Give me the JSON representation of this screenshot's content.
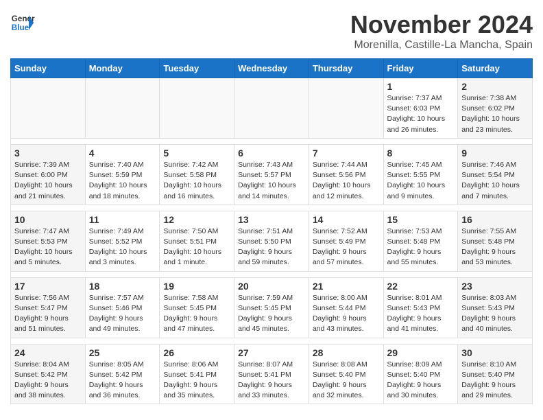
{
  "logo": {
    "line1": "General",
    "line2": "Blue"
  },
  "title": "November 2024",
  "location": "Morenilla, Castille-La Mancha, Spain",
  "weekdays": [
    "Sunday",
    "Monday",
    "Tuesday",
    "Wednesday",
    "Thursday",
    "Friday",
    "Saturday"
  ],
  "weeks": [
    {
      "days": [
        {
          "num": "",
          "info": "",
          "empty": true
        },
        {
          "num": "",
          "info": "",
          "empty": true
        },
        {
          "num": "",
          "info": "",
          "empty": true
        },
        {
          "num": "",
          "info": "",
          "empty": true
        },
        {
          "num": "",
          "info": "",
          "empty": true
        },
        {
          "num": "1",
          "info": "Sunrise: 7:37 AM\nSunset: 6:03 PM\nDaylight: 10 hours\nand 26 minutes."
        },
        {
          "num": "2",
          "info": "Sunrise: 7:38 AM\nSunset: 6:02 PM\nDaylight: 10 hours\nand 23 minutes.",
          "weekend": true
        }
      ]
    },
    {
      "days": [
        {
          "num": "3",
          "info": "Sunrise: 7:39 AM\nSunset: 6:00 PM\nDaylight: 10 hours\nand 21 minutes.",
          "weekend": true
        },
        {
          "num": "4",
          "info": "Sunrise: 7:40 AM\nSunset: 5:59 PM\nDaylight: 10 hours\nand 18 minutes."
        },
        {
          "num": "5",
          "info": "Sunrise: 7:42 AM\nSunset: 5:58 PM\nDaylight: 10 hours\nand 16 minutes."
        },
        {
          "num": "6",
          "info": "Sunrise: 7:43 AM\nSunset: 5:57 PM\nDaylight: 10 hours\nand 14 minutes."
        },
        {
          "num": "7",
          "info": "Sunrise: 7:44 AM\nSunset: 5:56 PM\nDaylight: 10 hours\nand 12 minutes."
        },
        {
          "num": "8",
          "info": "Sunrise: 7:45 AM\nSunset: 5:55 PM\nDaylight: 10 hours\nand 9 minutes."
        },
        {
          "num": "9",
          "info": "Sunrise: 7:46 AM\nSunset: 5:54 PM\nDaylight: 10 hours\nand 7 minutes.",
          "weekend": true
        }
      ]
    },
    {
      "days": [
        {
          "num": "10",
          "info": "Sunrise: 7:47 AM\nSunset: 5:53 PM\nDaylight: 10 hours\nand 5 minutes.",
          "weekend": true
        },
        {
          "num": "11",
          "info": "Sunrise: 7:49 AM\nSunset: 5:52 PM\nDaylight: 10 hours\nand 3 minutes."
        },
        {
          "num": "12",
          "info": "Sunrise: 7:50 AM\nSunset: 5:51 PM\nDaylight: 10 hours\nand 1 minute."
        },
        {
          "num": "13",
          "info": "Sunrise: 7:51 AM\nSunset: 5:50 PM\nDaylight: 9 hours\nand 59 minutes."
        },
        {
          "num": "14",
          "info": "Sunrise: 7:52 AM\nSunset: 5:49 PM\nDaylight: 9 hours\nand 57 minutes."
        },
        {
          "num": "15",
          "info": "Sunrise: 7:53 AM\nSunset: 5:48 PM\nDaylight: 9 hours\nand 55 minutes."
        },
        {
          "num": "16",
          "info": "Sunrise: 7:55 AM\nSunset: 5:48 PM\nDaylight: 9 hours\nand 53 minutes.",
          "weekend": true
        }
      ]
    },
    {
      "days": [
        {
          "num": "17",
          "info": "Sunrise: 7:56 AM\nSunset: 5:47 PM\nDaylight: 9 hours\nand 51 minutes.",
          "weekend": true
        },
        {
          "num": "18",
          "info": "Sunrise: 7:57 AM\nSunset: 5:46 PM\nDaylight: 9 hours\nand 49 minutes."
        },
        {
          "num": "19",
          "info": "Sunrise: 7:58 AM\nSunset: 5:45 PM\nDaylight: 9 hours\nand 47 minutes."
        },
        {
          "num": "20",
          "info": "Sunrise: 7:59 AM\nSunset: 5:45 PM\nDaylight: 9 hours\nand 45 minutes."
        },
        {
          "num": "21",
          "info": "Sunrise: 8:00 AM\nSunset: 5:44 PM\nDaylight: 9 hours\nand 43 minutes."
        },
        {
          "num": "22",
          "info": "Sunrise: 8:01 AM\nSunset: 5:43 PM\nDaylight: 9 hours\nand 41 minutes."
        },
        {
          "num": "23",
          "info": "Sunrise: 8:03 AM\nSunset: 5:43 PM\nDaylight: 9 hours\nand 40 minutes.",
          "weekend": true
        }
      ]
    },
    {
      "days": [
        {
          "num": "24",
          "info": "Sunrise: 8:04 AM\nSunset: 5:42 PM\nDaylight: 9 hours\nand 38 minutes.",
          "weekend": true
        },
        {
          "num": "25",
          "info": "Sunrise: 8:05 AM\nSunset: 5:42 PM\nDaylight: 9 hours\nand 36 minutes."
        },
        {
          "num": "26",
          "info": "Sunrise: 8:06 AM\nSunset: 5:41 PM\nDaylight: 9 hours\nand 35 minutes."
        },
        {
          "num": "27",
          "info": "Sunrise: 8:07 AM\nSunset: 5:41 PM\nDaylight: 9 hours\nand 33 minutes."
        },
        {
          "num": "28",
          "info": "Sunrise: 8:08 AM\nSunset: 5:40 PM\nDaylight: 9 hours\nand 32 minutes."
        },
        {
          "num": "29",
          "info": "Sunrise: 8:09 AM\nSunset: 5:40 PM\nDaylight: 9 hours\nand 30 minutes."
        },
        {
          "num": "30",
          "info": "Sunrise: 8:10 AM\nSunset: 5:40 PM\nDaylight: 9 hours\nand 29 minutes.",
          "weekend": true
        }
      ]
    }
  ]
}
